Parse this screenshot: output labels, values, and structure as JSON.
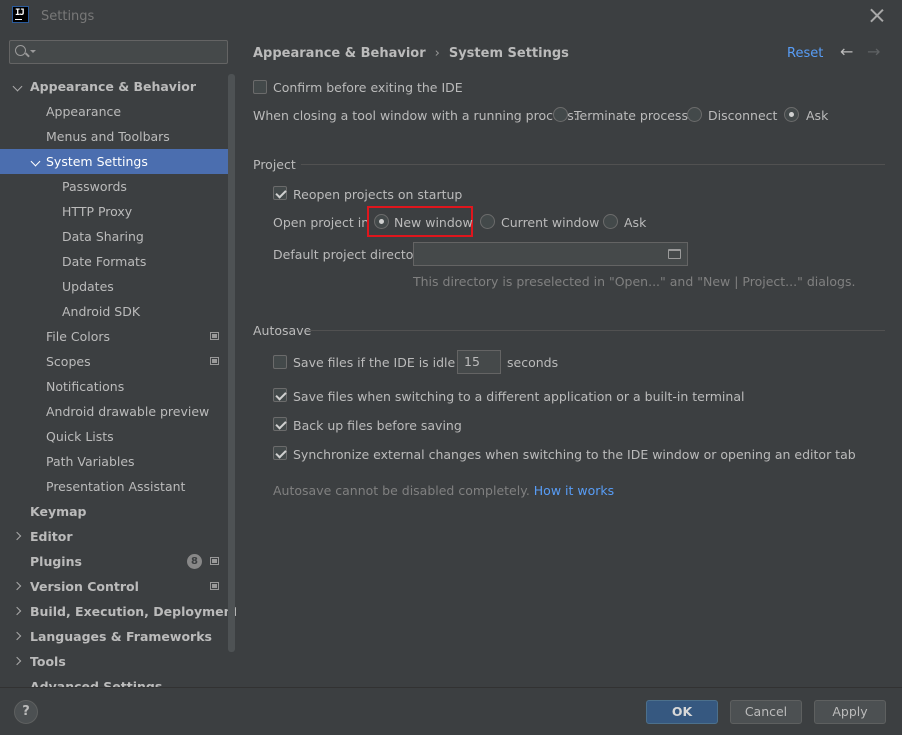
{
  "window": {
    "title": "Settings",
    "app_icon_text": "IJ"
  },
  "search": {
    "placeholder": ""
  },
  "sidebar": {
    "items": [
      {
        "label": "Appearance & Behavior"
      },
      {
        "label": "Appearance"
      },
      {
        "label": "Menus and Toolbars"
      },
      {
        "label": "System Settings"
      },
      {
        "label": "Passwords"
      },
      {
        "label": "HTTP Proxy"
      },
      {
        "label": "Data Sharing"
      },
      {
        "label": "Date Formats"
      },
      {
        "label": "Updates"
      },
      {
        "label": "Android SDK"
      },
      {
        "label": "File Colors"
      },
      {
        "label": "Scopes"
      },
      {
        "label": "Notifications"
      },
      {
        "label": "Android drawable preview"
      },
      {
        "label": "Quick Lists"
      },
      {
        "label": "Path Variables"
      },
      {
        "label": "Presentation Assistant"
      },
      {
        "label": "Keymap"
      },
      {
        "label": "Editor"
      },
      {
        "label": "Plugins",
        "badge": "8"
      },
      {
        "label": "Version Control"
      },
      {
        "label": "Build, Execution, Deployment"
      },
      {
        "label": "Languages & Frameworks"
      },
      {
        "label": "Tools"
      },
      {
        "label": "Advanced Settings"
      }
    ]
  },
  "header": {
    "breadcrumb_parent": "Appearance & Behavior",
    "breadcrumb_sep": "›",
    "breadcrumb_current": "System Settings",
    "reset_label": "Reset",
    "back_arrow": "←",
    "forward_arrow": "→"
  },
  "general": {
    "confirm_exit_label": "Confirm before exiting the IDE",
    "confirm_exit_checked": false,
    "closing_tool_window_label": "When closing a tool window with a running process:",
    "terminate_label": "Terminate process",
    "disconnect_label": "Disconnect",
    "ask_label": "Ask",
    "selected": "Ask"
  },
  "project": {
    "section_title": "Project",
    "reopen_label": "Reopen projects on startup",
    "reopen_checked": true,
    "open_in_label": "Open project in",
    "new_window_label": "New window",
    "current_window_label": "Current window",
    "ask_label": "Ask",
    "open_in_selected": "New window",
    "default_dir_label": "Default project directory:",
    "default_dir_value": "",
    "default_dir_hint": "This directory is preselected in \"Open...\" and \"New | Project...\" dialogs."
  },
  "autosave": {
    "section_title": "Autosave",
    "idle_label": "Save files if the IDE is idle for",
    "idle_checked": false,
    "idle_value": "15",
    "idle_unit": "seconds",
    "switch_app_label": "Save files when switching to a different application or a built-in terminal",
    "switch_app_checked": true,
    "backup_label": "Back up files before saving",
    "backup_checked": true,
    "sync_label": "Synchronize external changes when switching to the IDE window or opening an editor tab",
    "sync_checked": true,
    "note": "Autosave cannot be disabled completely.",
    "note_link": "How it works"
  },
  "footer": {
    "help_label": "?",
    "ok_label": "OK",
    "cancel_label": "Cancel",
    "apply_label": "Apply"
  },
  "colors": {
    "background": "#3c3f41",
    "selection": "#4b6eaf",
    "link": "#589df6",
    "primary_button": "#365880",
    "highlight_box": "#e0161d"
  }
}
